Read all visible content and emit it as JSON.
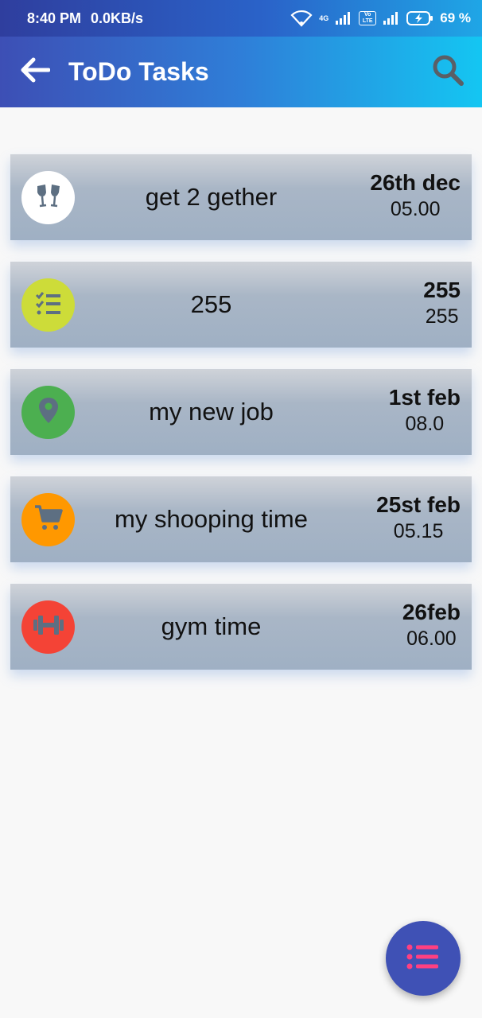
{
  "status_bar": {
    "time": "8:40 PM",
    "speed": "0.0KB/s",
    "network_label": "4G",
    "volte_label": "Vo LTE",
    "battery": "69 %"
  },
  "app_bar": {
    "title": "ToDo Tasks",
    "back_icon": "arrow-back-icon",
    "search_icon": "search-icon"
  },
  "tasks": [
    {
      "title": "get 2 gether",
      "date": "26th dec",
      "time": "05.00",
      "icon": "cheers-icon",
      "color": "#ffffff"
    },
    {
      "title": "255",
      "date": "255",
      "time": "255",
      "icon": "checklist-icon",
      "color": "#cddc39"
    },
    {
      "title": "my new job",
      "date": "1st feb",
      "time": "08.0",
      "icon": "location-pin-icon",
      "color": "#4caf50"
    },
    {
      "title": "my shooping time",
      "date": "25st feb",
      "time": "05.15",
      "icon": "shopping-cart-icon",
      "color": "#ff9800"
    },
    {
      "title": "gym time",
      "date": "26feb",
      "time": "06.00",
      "icon": "dumbbell-icon",
      "color": "#f44336"
    }
  ],
  "fab": {
    "icon": "list-icon",
    "color": "#3f51b5"
  }
}
